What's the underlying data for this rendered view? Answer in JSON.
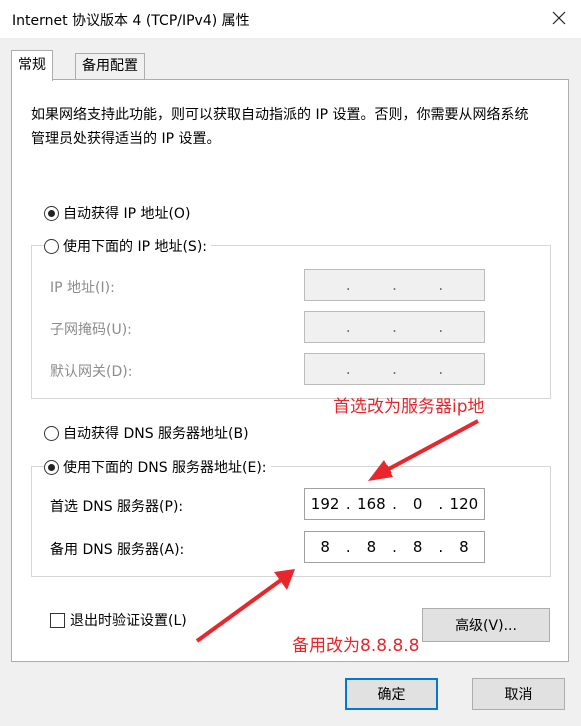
{
  "window": {
    "title": "Internet 协议版本 4 (TCP/IPv4) 属性",
    "close_icon": "close-icon"
  },
  "tabs": [
    {
      "label": "常规",
      "active": true
    },
    {
      "label": "备用配置",
      "active": false
    }
  ],
  "description": "如果网络支持此功能，则可以获取自动指派的 IP 设置。否则，你需要从网络系统管理员处获得适当的 IP 设置。",
  "ip_section": {
    "auto_label": "自动获得 IP 地址(O)",
    "manual_label": "使用下面的 IP 地址(S):",
    "selected": "auto",
    "fields": [
      {
        "label": "IP 地址(I):",
        "octets": [
          "",
          "",
          "",
          ""
        ]
      },
      {
        "label": "子网掩码(U):",
        "octets": [
          "",
          "",
          "",
          ""
        ]
      },
      {
        "label": "默认网关(D):",
        "octets": [
          "",
          "",
          "",
          ""
        ]
      }
    ]
  },
  "dns_section": {
    "auto_label": "自动获得 DNS 服务器地址(B)",
    "manual_label": "使用下面的 DNS 服务器地址(E):",
    "selected": "manual",
    "preferred": {
      "label": "首选 DNS 服务器(P):",
      "octets": [
        "192",
        "168",
        "0",
        "120"
      ]
    },
    "alternate": {
      "label": "备用 DNS 服务器(A):",
      "octets": [
        "8",
        "8",
        "8",
        "8"
      ]
    }
  },
  "validate_on_exit": {
    "label": "退出时验证设置(L)",
    "checked": false
  },
  "buttons": {
    "advanced": "高级(V)...",
    "ok": "确定",
    "cancel": "取消"
  },
  "annotations": {
    "preferred_note": "首选改为服务器ip地",
    "alternate_note": "备用改为8.8.8.8",
    "color": "#e8262b"
  },
  "colors": {
    "accent": "#0078d7",
    "window_bg": "#f0f0f0",
    "panel_bg": "#ffffff"
  }
}
